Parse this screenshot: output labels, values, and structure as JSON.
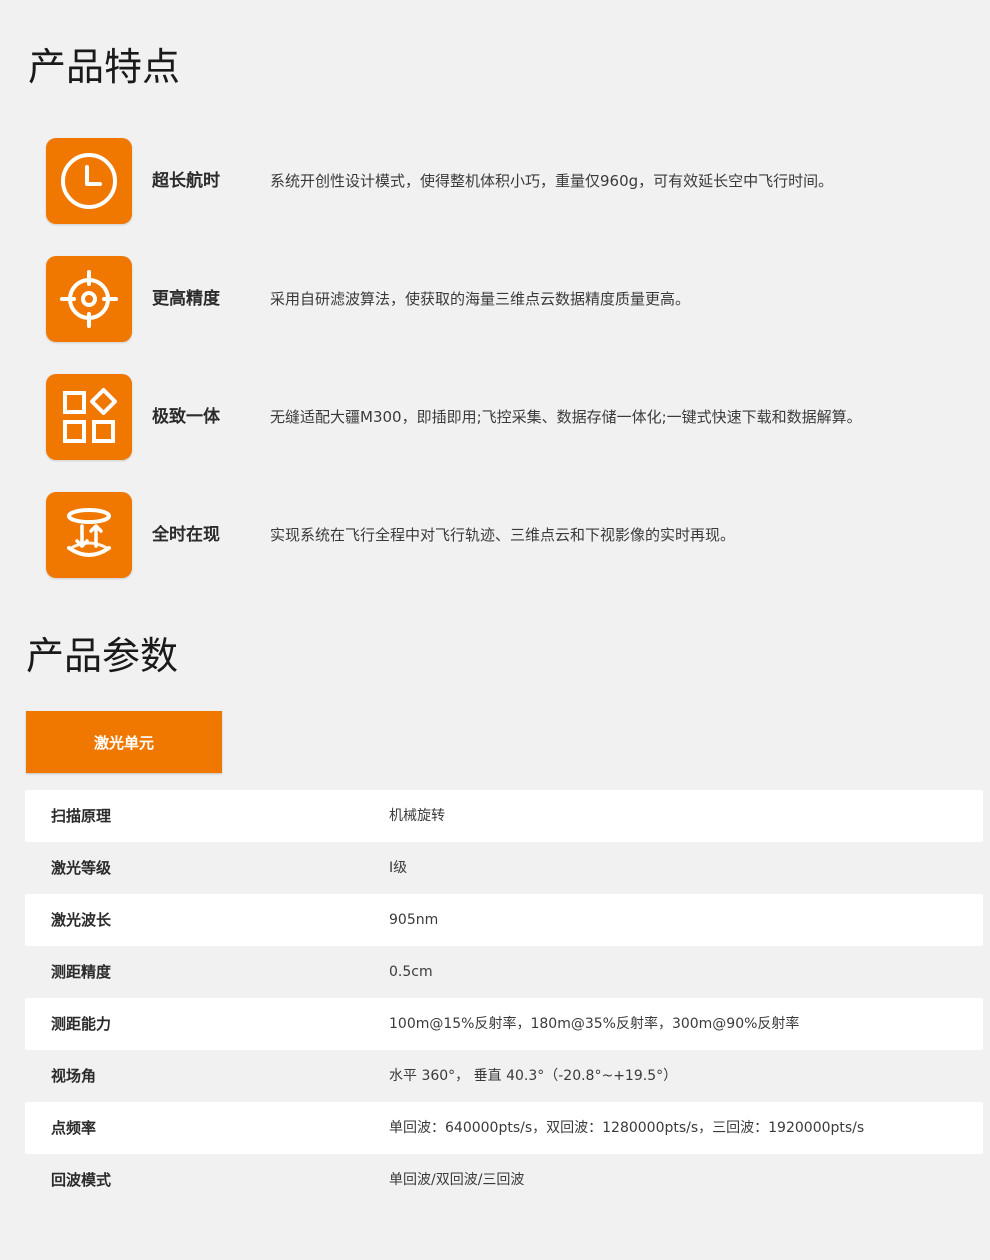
{
  "features_section": {
    "title": "产品特点",
    "items": [
      {
        "icon": "clock-icon",
        "title": "超长航时",
        "desc": "系统开创性设计模式，使得整机体积小巧，重量仅960g，可有效延长空中飞行时间。"
      },
      {
        "icon": "crosshair-icon",
        "title": "更高精度",
        "desc": "采用自研滤波算法，使获取的海量三维点云数据精度质量更高。"
      },
      {
        "icon": "integration-grid-icon",
        "title": "极致一体",
        "desc": "无缝适配大疆M300，即插即用;飞控采集、数据存储一体化;一键式快速下载和数据解算。"
      },
      {
        "icon": "realtime-replay-icon",
        "title": "全时在现",
        "desc": "实现系统在飞行全程中对飞行轨迹、三维点云和下视影像的实时再现。"
      }
    ]
  },
  "params_section": {
    "title": "产品参数",
    "tab_label": "激光单元",
    "rows": [
      {
        "label": "扫描原理",
        "value": "机械旋转"
      },
      {
        "label": "激光等级",
        "value": "I级"
      },
      {
        "label": "激光波长",
        "value": "905nm"
      },
      {
        "label": "测距精度",
        "value": "0.5cm"
      },
      {
        "label": "测距能力",
        "value": "100m@15%反射率，180m@35%反射率，300m@90%反射率"
      },
      {
        "label": "视场角",
        "value": "水平 360°， 垂直 40.3°（-20.8°~+19.5°）"
      },
      {
        "label": "点频率",
        "value": "单回波：640000pts/s，双回波：1280000pts/s，三回波：1920000pts/s"
      },
      {
        "label": "回波模式",
        "value": "单回波/双回波/三回波"
      }
    ]
  },
  "colors": {
    "accent": "#f07800",
    "background": "#f1f1f1",
    "row_white": "#ffffff"
  }
}
